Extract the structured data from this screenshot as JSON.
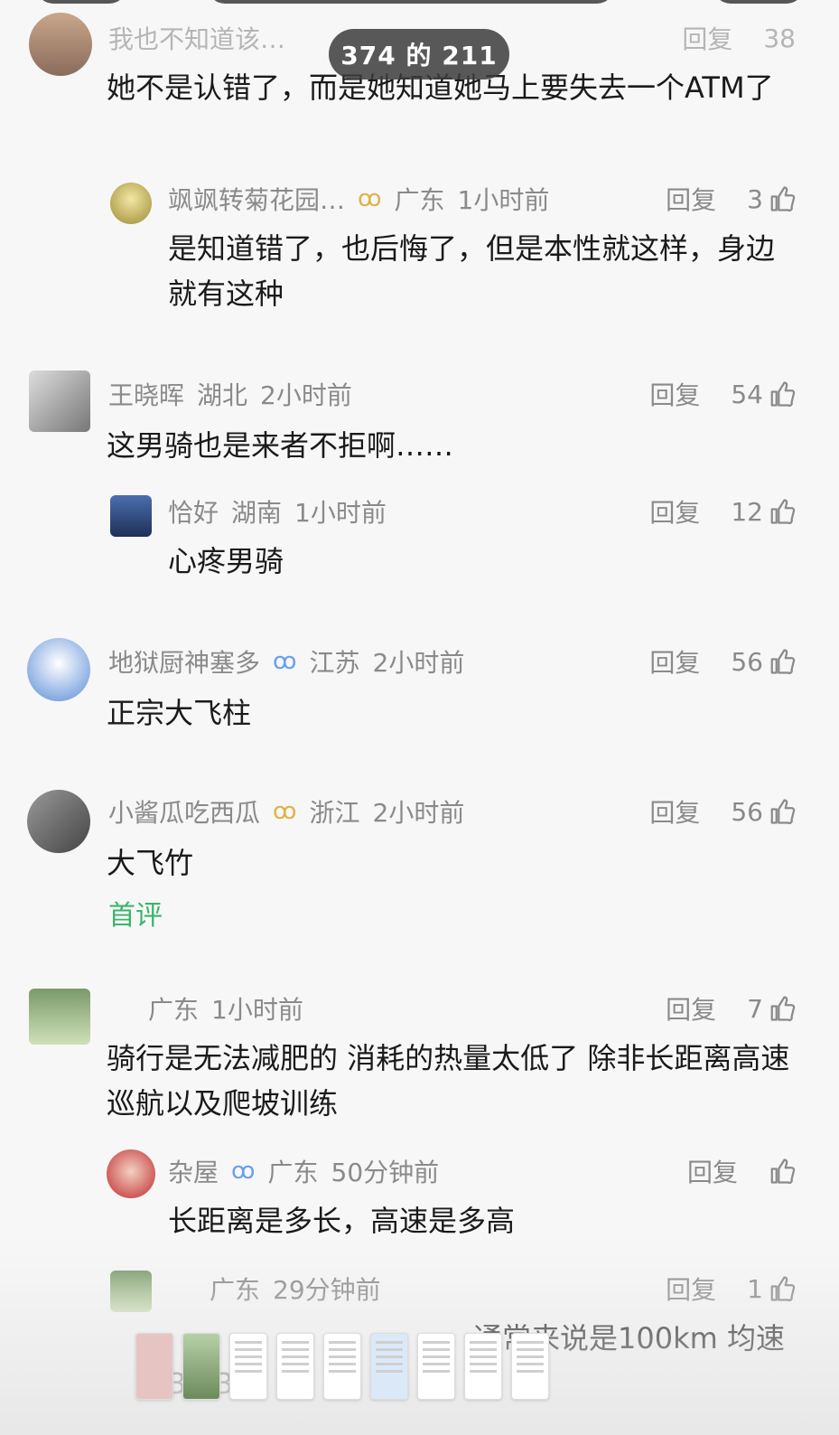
{
  "viewer": {
    "counter": "374 的 211"
  },
  "comments": [
    {
      "id": "c0",
      "user": "我也不知道该…",
      "location": "",
      "time": "",
      "reply": "回复",
      "likes": "38",
      "text": "她不是认错了，而是她知道她马上要失去一个ATM了",
      "replies": [
        {
          "user": "飒飒转菊花园…",
          "location": "广东",
          "time": "1小时前",
          "reply": "回复",
          "likes": "3",
          "text": "是知道错了，也后悔了，但是本性就这样，身边就有这种"
        }
      ]
    },
    {
      "id": "c1",
      "user": "王晓晖",
      "location": "湖北",
      "time": "2小时前",
      "reply": "回复",
      "likes": "54",
      "text": "这男骑也是来者不拒啊……",
      "replies": [
        {
          "user": "恰好",
          "location": "湖南",
          "time": "1小时前",
          "reply": "回复",
          "likes": "12",
          "text": "心疼男骑"
        }
      ]
    },
    {
      "id": "c2",
      "user": "地狱厨神塞多",
      "location": "江苏",
      "time": "2小时前",
      "reply": "回复",
      "likes": "56",
      "text": "正宗大飞柱"
    },
    {
      "id": "c3",
      "user": "小酱瓜吃西瓜",
      "location": "浙江",
      "time": "2小时前",
      "reply": "回复",
      "likes": "56",
      "text": "大飞竹",
      "tag": "首评"
    },
    {
      "id": "c4",
      "user": "",
      "location": "广东",
      "time": "1小时前",
      "reply": "回复",
      "likes": "7",
      "text": "骑行是无法减肥的 消耗的热量太低了 除非长距离高速巡航以及爬坡训练",
      "replies": [
        {
          "user": "杂屋",
          "location": "广东",
          "time": "50分钟前",
          "reply": "回复",
          "likes": "",
          "text": "长距离是多长，高速是多高"
        },
        {
          "user": "",
          "location": "广东",
          "time": "29分钟前",
          "reply": "回复",
          "likes": "1",
          "text": "通常来说是100km 均速",
          "text_line2": "30-35"
        }
      ]
    }
  ],
  "colors": {
    "accent_green": "#3bb56a",
    "muted": "#8a8a8a",
    "vip_blue": "#6a9ff0",
    "vip_gold": "#e0b24a"
  }
}
